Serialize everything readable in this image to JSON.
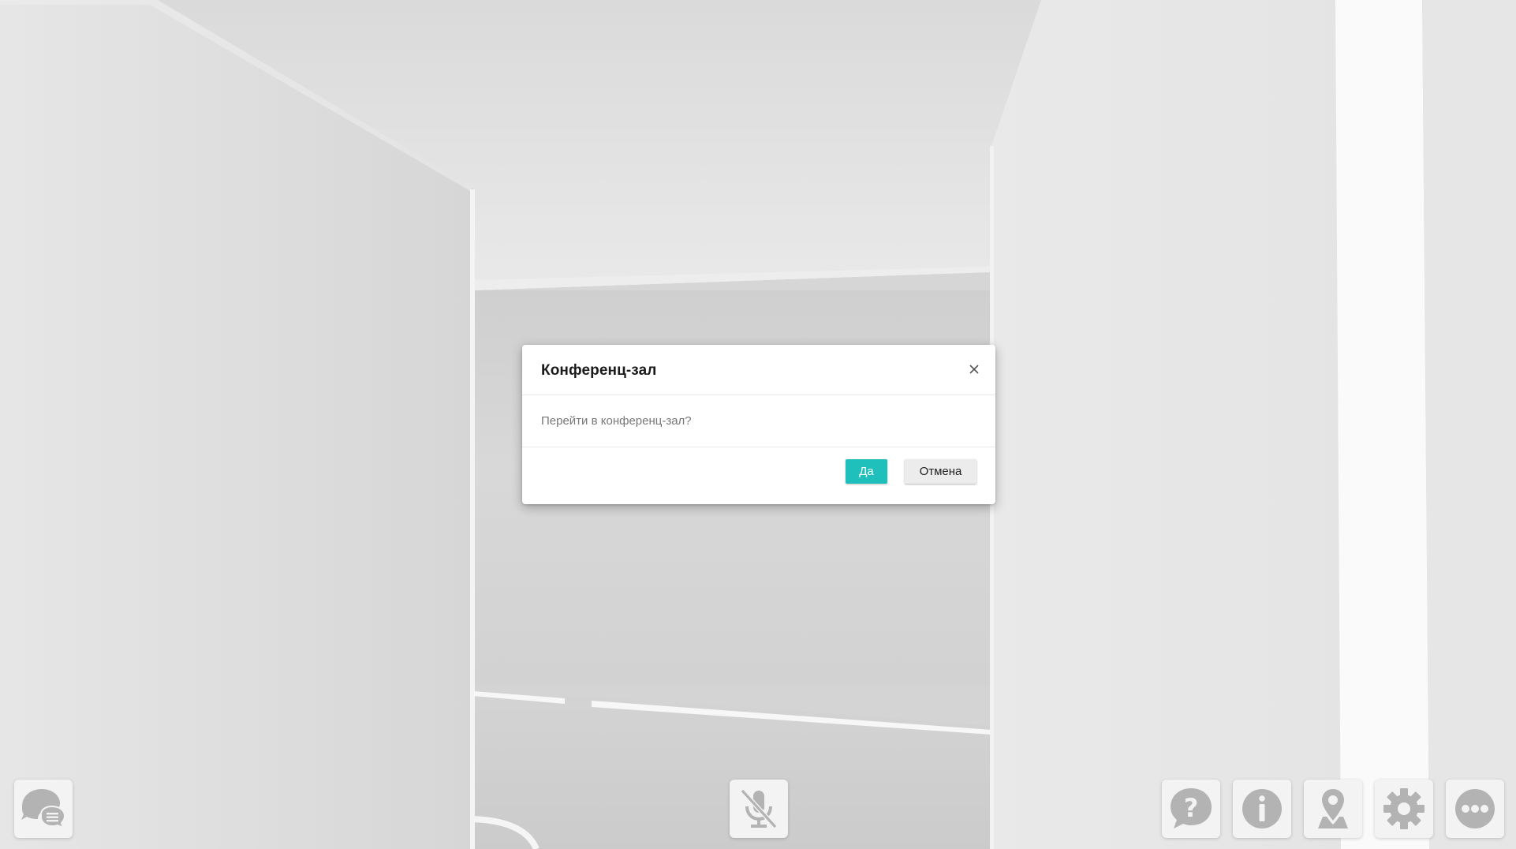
{
  "dialog": {
    "title": "Конференц-зал",
    "message": "Перейти в конференц-зал?",
    "confirm_label": "Да",
    "cancel_label": "Отмена",
    "close_icon": "close-icon"
  },
  "toolbar": {
    "left": [
      {
        "name": "chat-button",
        "icon": "chat-bubbles-icon"
      }
    ],
    "center": [
      {
        "name": "microphone-button",
        "icon": "microphone-muted-icon"
      }
    ],
    "right": [
      {
        "name": "help-button",
        "icon": "question-icon"
      },
      {
        "name": "info-button",
        "icon": "info-icon"
      },
      {
        "name": "location-button",
        "icon": "map-pin-icon"
      },
      {
        "name": "settings-button",
        "icon": "gear-icon"
      },
      {
        "name": "more-button",
        "icon": "more-dots-icon"
      }
    ]
  },
  "colors": {
    "accent": "#1fbfbc",
    "icon_gray": "#b3b3b3",
    "button_bg": "#f3f3f3",
    "scene_bg": "#d8d8d8"
  }
}
